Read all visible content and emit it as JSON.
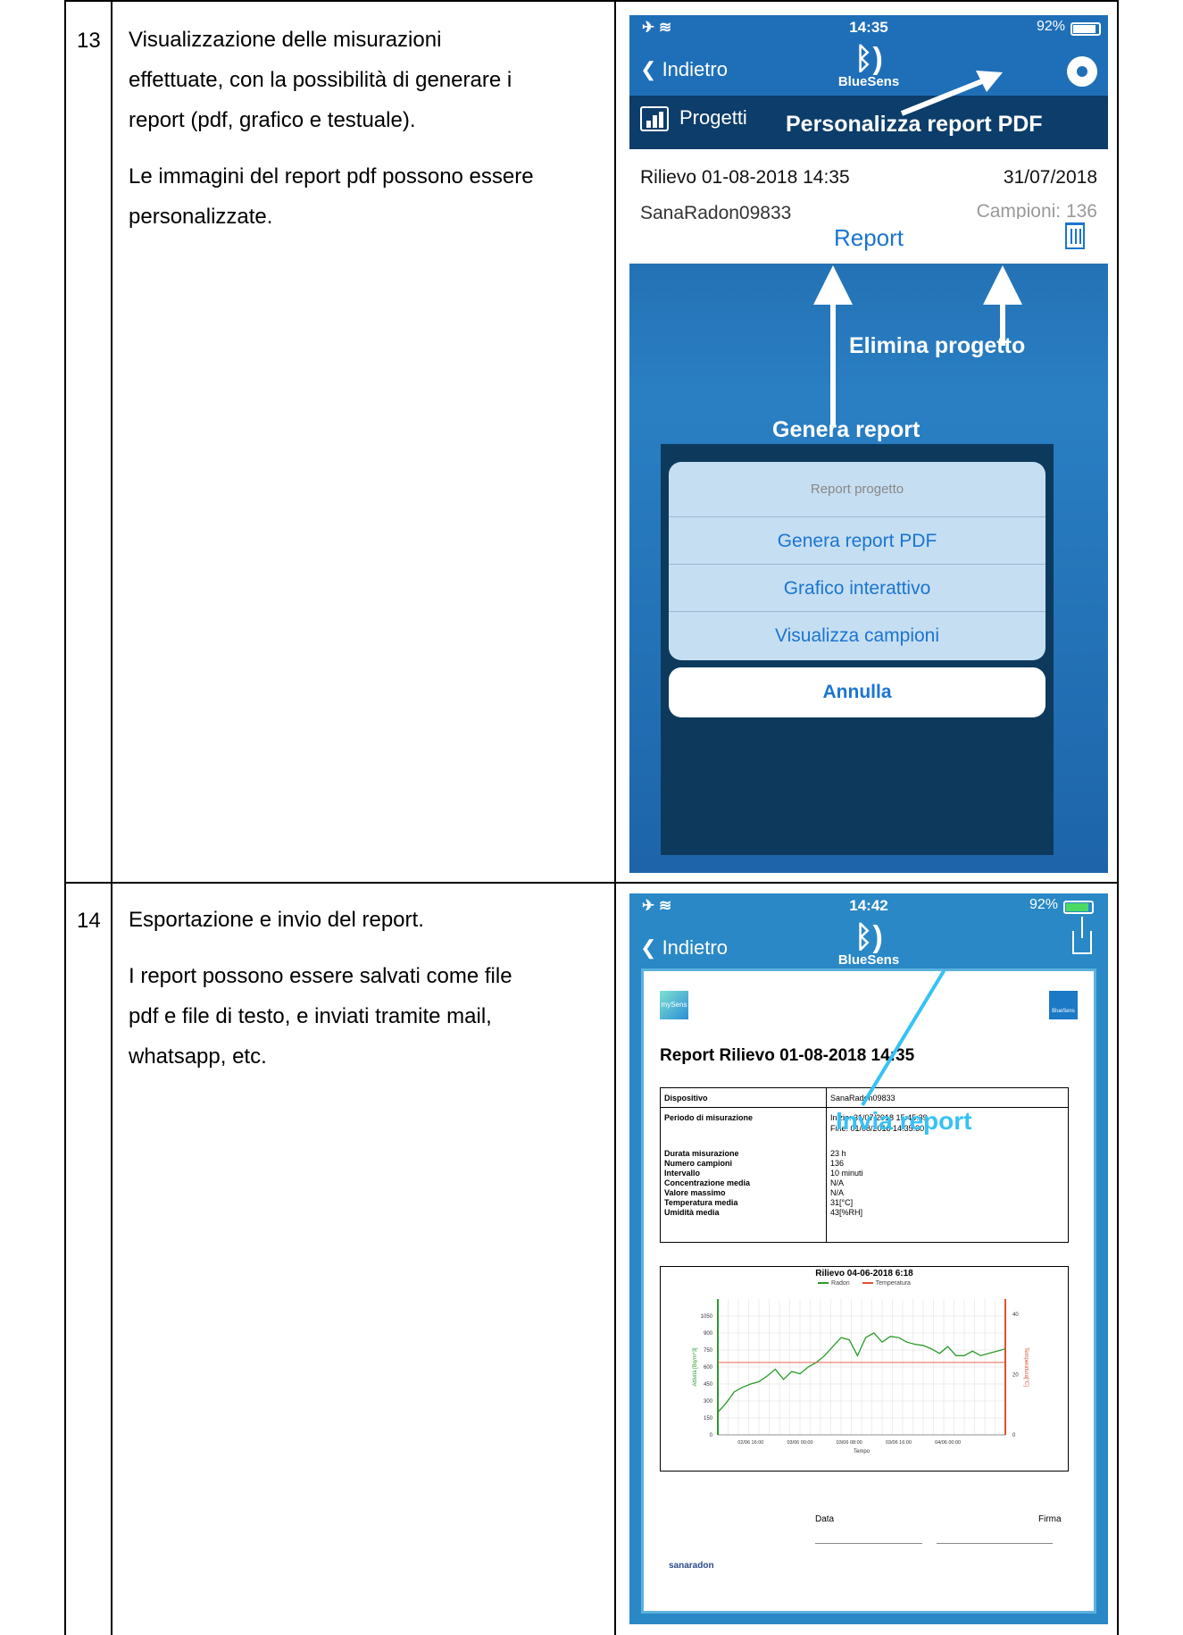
{
  "rows": [
    {
      "number": "13",
      "lines": [
        "Visualizzazione delle misurazioni",
        "effettuate, con la possibilità di generare i",
        "report (pdf, grafico e testuale)."
      ],
      "lines2": [
        "Le immagini del report pdf possono essere",
        "personalizzate."
      ]
    },
    {
      "number": "14",
      "lines": [
        "Esportazione e invio del report."
      ],
      "lines2": [
        "I report possono essere salvati come file",
        "pdf e file di testo, e inviati tramite mail,",
        "whatsapp, etc."
      ]
    }
  ],
  "phone1": {
    "status": {
      "time": "14:35",
      "battery": "92%"
    },
    "back_label": "Indietro",
    "brand": "BlueSens",
    "projects_label": "Progetti",
    "annot_pdf": "Personalizza report PDF",
    "survey_title": "Rilievo 01-08-2018 14:35",
    "survey_date": "31/07/2018",
    "device": "SanaRadon09833",
    "samples": "Campioni: 136",
    "report_link": "Report",
    "annot_delete": "Elimina progetto",
    "annot_generate": "Genera report",
    "sheet_title": "Report progetto",
    "sheet_options": [
      "Genera report PDF",
      "Grafico interattivo",
      "Visualizza campioni"
    ],
    "cancel_label": "Annulla"
  },
  "phone2": {
    "status": {
      "time": "14:42",
      "battery": "92%"
    },
    "back_label": "Indietro",
    "brand": "BlueSens",
    "logo_left": "mySens",
    "logo_right": "BlueSens",
    "doc_title": "Report Rilievo 01-08-2018 14:35",
    "info": {
      "device_key": "Dispositivo",
      "device_val": "SanaRadon09833",
      "period_key": "Periodo di misurazione",
      "period_val1": "Inizio: 31/07/2018 15:45:39",
      "period_val2": "Fine: 01/08/2018 14:35:30",
      "stats": [
        {
          "k": "Durata misurazione",
          "v": "23 h"
        },
        {
          "k": "Numero campioni",
          "v": "136"
        },
        {
          "k": "Intervallo",
          "v": "10 minuti"
        },
        {
          "k": "Concentrazione media",
          "v": "N/A"
        },
        {
          "k": "Valore massimo",
          "v": "N/A"
        },
        {
          "k": "Temperatura media",
          "v": "31[°C]"
        },
        {
          "k": "Umidità media",
          "v": "43[%RH]"
        }
      ]
    },
    "annot_send": "Invia report",
    "signature_date": "Data",
    "signature_sign": "Firma",
    "footer_logo": "sanaradon"
  },
  "chart_data": {
    "type": "line",
    "title": "Rilievo 04-06-2018 6:18",
    "xlabel": "Tempo",
    "ylabel": "Attività [Bq/m^3]",
    "y2label": "Temperatura[°C]",
    "x_ticks": [
      "02/06 16:00",
      "03/06 00:00",
      "03/06 08:00",
      "03/06 16:00",
      "04/06 00:00"
    ],
    "y_ticks": [
      0,
      150,
      300,
      450,
      600,
      750,
      900,
      1050
    ],
    "y2_ticks": [
      0,
      20,
      40
    ],
    "ylim": [
      0,
      1200
    ],
    "y2lim": [
      0,
      45
    ],
    "series": [
      {
        "name": "Radon",
        "color": "#2a9a2a",
        "axis": "left",
        "x": [
          0,
          2,
          4,
          6,
          8,
          10,
          12,
          14,
          16,
          18,
          20,
          22,
          24,
          26,
          28,
          30,
          32,
          34,
          36,
          38,
          40,
          42,
          44,
          46,
          48,
          50,
          52,
          54,
          56,
          58,
          60,
          62,
          64,
          66,
          68,
          70
        ],
        "values": [
          200,
          280,
          380,
          420,
          450,
          470,
          520,
          580,
          490,
          560,
          540,
          600,
          640,
          700,
          780,
          860,
          840,
          700,
          860,
          900,
          820,
          870,
          860,
          820,
          800,
          790,
          760,
          720,
          780,
          700,
          700,
          740,
          700,
          720,
          740,
          760
        ]
      },
      {
        "name": "Temperatura",
        "color": "#e05030",
        "axis": "right",
        "x": [
          0,
          70
        ],
        "values": [
          24,
          24
        ]
      }
    ],
    "grid": true,
    "legend": "top"
  },
  "colors": {
    "accent": "#1a75d0",
    "annot_cyan": "#36c2f5"
  }
}
